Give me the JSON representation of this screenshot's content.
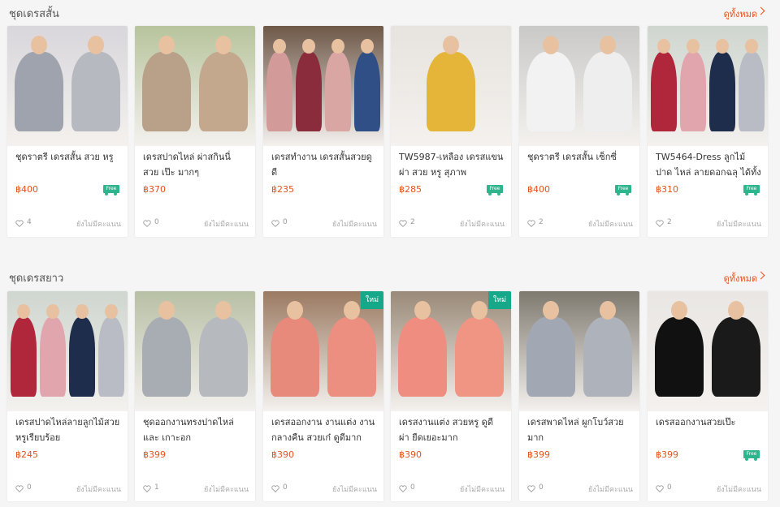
{
  "sections": [
    {
      "title": "ชุดเดรสสั้น",
      "see_all": "ดูทั้งหมด",
      "products": [
        {
          "name": "ชุดราตรี เดรสสั้น สวย หรู",
          "price": "฿400",
          "free_shipping": true,
          "likes": "4",
          "rating": "ยังไม่มีคะแนน",
          "new": false,
          "colors": [
            "#9ea3ad",
            "#b7b9c0"
          ],
          "bg": "#d9d6dc"
        },
        {
          "name": "เดรสปาดไหล่ ผ่าสกินนี่ สวย เป๊ะ มากๆ",
          "price": "฿370",
          "free_shipping": false,
          "likes": "0",
          "rating": "ยังไม่มีคะแนน",
          "new": false,
          "colors": [
            "#b8a089",
            "#c3a88d"
          ],
          "bg": "#b7c49c"
        },
        {
          "name": "เดรสทำงาน เดรสสั้นสวยดูดี",
          "price": "฿235",
          "free_shipping": false,
          "likes": "0",
          "rating": "ยังไม่มีคะแนน",
          "new": false,
          "colors": [
            "#d29a98",
            "#8a2c3c",
            "#d9a6a4",
            "#2f4f86"
          ],
          "bg": "#6e5848"
        },
        {
          "name": "TW5987-เหลือง เดรสแขน ผ่า สวย หรู สุภาพ",
          "price": "฿285",
          "free_shipping": true,
          "likes": "2",
          "rating": "ยังไม่มีคะแนน",
          "new": false,
          "colors": [
            "#e5b53a"
          ],
          "bg": "#e7e3de"
        },
        {
          "name": "ชุดราตรี เดรสสั้น เซ็กซี่",
          "price": "฿400",
          "free_shipping": true,
          "likes": "2",
          "rating": "ยังไม่มีคะแนน",
          "new": false,
          "colors": [
            "#f2f2f2",
            "#eeeeee"
          ],
          "bg": "#c9c9c7"
        },
        {
          "name": "TW5464-Dress ลูกไม้ปาด ไหล่ ลายดอกฉลุ ได้ทั้งงา...",
          "price": "฿310",
          "free_shipping": true,
          "likes": "2",
          "rating": "ยังไม่มีคะแนน",
          "new": false,
          "colors": [
            "#b0263a",
            "#e1a6ad",
            "#1f2d4d",
            "#b9bcc4"
          ],
          "bg": "#cfd6cf"
        }
      ]
    },
    {
      "title": "ชุดเดรสยาว",
      "see_all": "ดูทั้งหมด",
      "products": [
        {
          "name": "เดรสปาดไหล่ลายลูกไม้สวย หรูเรียบร้อย",
          "price": "฿245",
          "free_shipping": false,
          "likes": "0",
          "rating": "ยังไม่มีคะแนน",
          "new": false,
          "colors": [
            "#b0263a",
            "#e1a6ad",
            "#1f2d4d",
            "#b9bcc4"
          ],
          "bg": "#cfd6cf"
        },
        {
          "name": "ชุดออกงานทรงปาดไหล่และ เกาะอก",
          "price": "฿399",
          "free_shipping": false,
          "likes": "1",
          "rating": "ยังไม่มีคะแนน",
          "new": false,
          "colors": [
            "#a8adb3",
            "#b6b9be"
          ],
          "bg": "#b8c0a5"
        },
        {
          "name": "เดรสออกงาน งานแต่ง งาน กลางคืน สวยเก๋ ดูดีมาก",
          "price": "฿390",
          "free_shipping": false,
          "likes": "0",
          "rating": "ยังไม่มีคะแนน",
          "new": true,
          "new_label": "ใหม่",
          "colors": [
            "#e7897b",
            "#ec8e80"
          ],
          "bg": "#9b7a62"
        },
        {
          "name": "เดรสงานแต่ง สวยหรู ดูดี ผ่า ยืดเยอะมาก",
          "price": "฿390",
          "free_shipping": false,
          "likes": "0",
          "rating": "ยังไม่มีคะแนน",
          "new": true,
          "new_label": "ใหม่",
          "colors": [
            "#ef8e80",
            "#f09484"
          ],
          "bg": "#9a8a78"
        },
        {
          "name": "เดรสพาดไหล่ ผูกโบว์สวย มาก",
          "price": "฿399",
          "free_shipping": false,
          "likes": "0",
          "rating": "ยังไม่มีคะแนน",
          "new": false,
          "colors": [
            "#a2a8b3",
            "#aeb3bb"
          ],
          "bg": "#7f7a70"
        },
        {
          "name": "เดรสออกงานสวยเป๊ะ",
          "price": "฿399",
          "free_shipping": true,
          "likes": "0",
          "rating": "ยังไม่มีคะแนน",
          "new": false,
          "colors": [
            "#111111",
            "#1a1a1a"
          ],
          "bg": "#e9e6e4"
        }
      ]
    }
  ],
  "free_badge_text": "Free"
}
